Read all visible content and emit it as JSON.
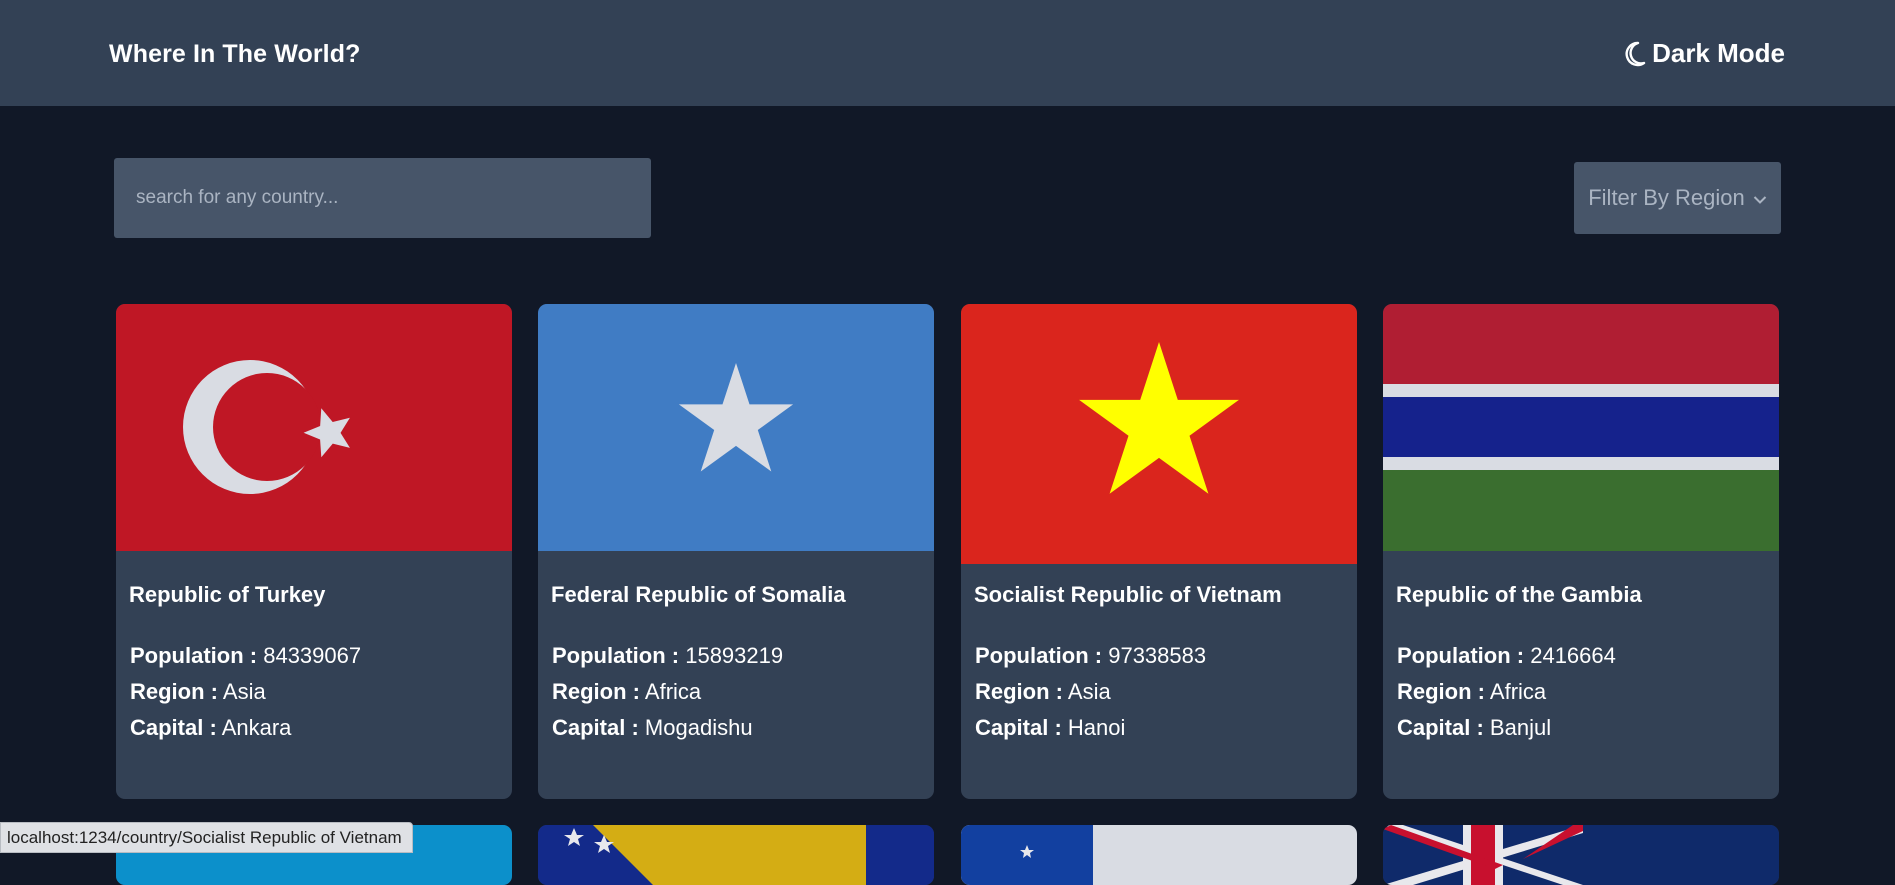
{
  "header": {
    "title": "Where In The World?",
    "theme_toggle_label": "Dark Mode",
    "theme_icon": "moon-icon"
  },
  "search": {
    "placeholder": "search for any country...",
    "value": ""
  },
  "filter": {
    "label": "Filter By Region",
    "icon": "chevron-down-icon"
  },
  "labels": {
    "population": "Population :",
    "region": "Region :",
    "capital": "Capital :"
  },
  "countries": [
    {
      "name": "Republic of Turkey",
      "population": "84339067",
      "region": "Asia",
      "capital": "Ankara",
      "flag": "turkey-flag"
    },
    {
      "name": "Federal Republic of Somalia",
      "population": "15893219",
      "region": "Africa",
      "capital": "Mogadishu",
      "flag": "somalia-flag"
    },
    {
      "name": "Socialist Republic of Vietnam",
      "population": "97338583",
      "region": "Asia",
      "capital": "Hanoi",
      "flag": "vietnam-flag"
    },
    {
      "name": "Republic of the Gambia",
      "population": "2416664",
      "region": "Africa",
      "capital": "Banjul",
      "flag": "gambia-flag"
    }
  ],
  "partial_cards": [
    "kazakhstan-flag",
    "bosnia-flag",
    "flag-partial",
    "australia-flag"
  ],
  "status_bar": {
    "url": "localhost:1234/country/Socialist Republic of Vietnam"
  },
  "colors": {
    "background": "#111827",
    "header": "#334155",
    "card": "#334155",
    "input": "#475569"
  }
}
